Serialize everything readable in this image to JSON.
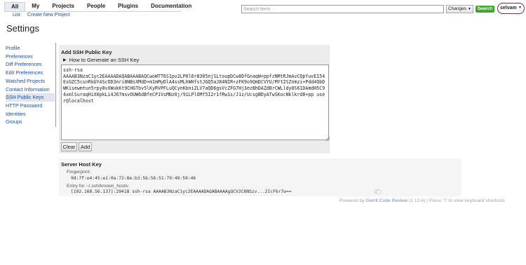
{
  "nav": {
    "menu": [
      {
        "label": "All",
        "active": true
      },
      {
        "label": "My",
        "active": false
      },
      {
        "label": "Projects",
        "active": false
      },
      {
        "label": "People",
        "active": false
      },
      {
        "label": "Plugins",
        "active": false
      },
      {
        "label": "Documentation",
        "active": false
      }
    ],
    "sub_menu": [
      "List",
      "Create New Project"
    ]
  },
  "search": {
    "placeholder": "Search term",
    "scope": "Changes",
    "button_label": "Search"
  },
  "user": {
    "name": "selvam"
  },
  "page": {
    "title": "Settings"
  },
  "sidebar": {
    "items": [
      {
        "label": "Profile",
        "active": false
      },
      {
        "label": "Preferences",
        "active": false
      },
      {
        "label": "Diff Preferences",
        "active": false
      },
      {
        "label": "Edit Preferences",
        "active": false
      },
      {
        "label": "Watched Projects",
        "active": false
      },
      {
        "label": "Contact Information",
        "active": false
      },
      {
        "label": "SSH Public Keys",
        "active": true
      },
      {
        "label": "HTTP Password",
        "active": false
      },
      {
        "label": "Identities",
        "active": false
      },
      {
        "label": "Groups",
        "active": false
      }
    ]
  },
  "ssh": {
    "heading": "Add SSH Public Key",
    "howto_label": "How to Generate an SSH Key",
    "key_value": "ssh-rsa\nAAAAB3NzaC1yc2EAAAADAQABAAABAQCwoWTT6S1pv2LP0l6r8305njSLtoupDCw8DfGnaqW+ppfzNMtRJmAvCQpYuvE154EsGZC5csnRkUYAScOD3nri8NBsXMdD+m1mMyDlA4ssMLhWHfstJGQ5aJ84NIR+zFK9o9QmDCVYU/MYt2SZnmzi+Pdd4QbDWKisewmtun5rpy8vXWukKt9CHGTbv5lKyRVPFLuQCynKbniZLV7aQD6gsVcZFG7Hj3ezBhDAZdBrCWLldy0S61DAmdH5C94xmlSuraqHiX0pkLi4J67msvOUW6dBfeCP1VsMNz0j/91LPlOMf5I2r1fRw1s/J1z/UcsgBDyATwSKocNklkrd8+pp user@localhost",
    "clear_label": "Clear",
    "add_label": "Add"
  },
  "server_host_key": {
    "heading": "Server Host Key",
    "fingerprint_label": "Fingerprint:",
    "fingerprint_value": "9d:7f:e4:45:e1:0a:72:8e:b3:5b:56:51:79:49:59:46",
    "entry_label": "Entry for ~/.ssh/known_hosts:",
    "entry_value": "[192.168.56.137]:29418 ssh-rsa AAAAB3NzaC1yc2EAAAADAQABAAAAgQCV2C8NSzv...2IcF6r7w=="
  },
  "footer": {
    "prefix": "Powered by ",
    "gerrit_link": "Gerrit Code Review",
    "suffix": " (2.13.4) | Press '?' to view keyboard shortcuts"
  },
  "colors": {
    "link": "#1a4f9e",
    "search_button": "#4aa13c",
    "user_border": "#9c1a45",
    "active_nav": "#dfe6f2"
  }
}
